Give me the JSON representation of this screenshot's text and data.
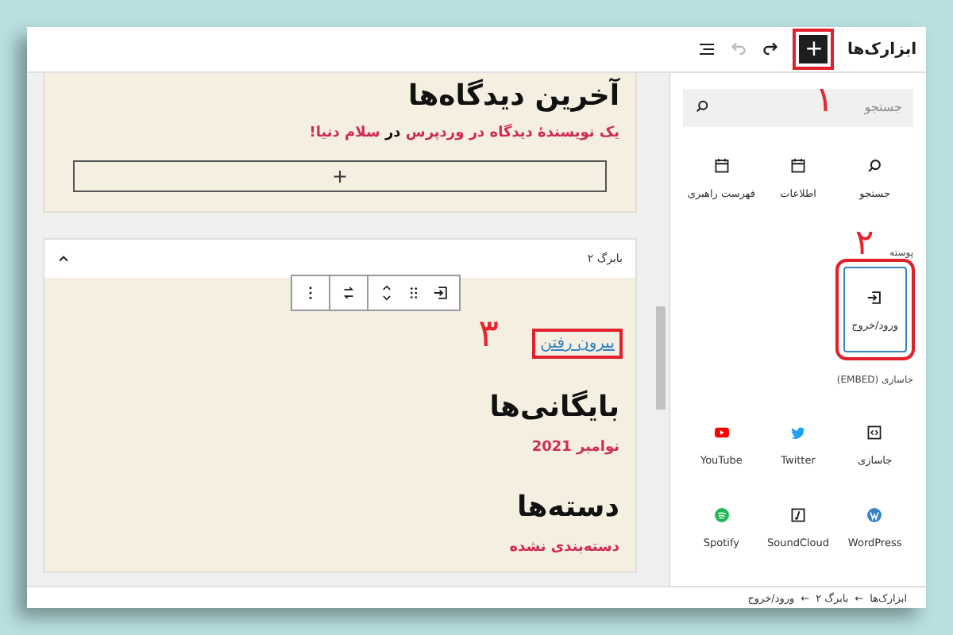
{
  "header": {
    "title": "ابزارک‌ها",
    "add_button": {
      "label": "+",
      "highlighted": true,
      "annotation": "۱"
    },
    "tools": [
      {
        "kind": "redo",
        "disabled": false
      },
      {
        "kind": "undo",
        "disabled": true
      },
      {
        "kind": "list",
        "disabled": false
      }
    ]
  },
  "sidebar": {
    "search": {
      "placeholder": "جستجو"
    },
    "tiles": [
      {
        "kind": "search",
        "label": "جستجو",
        "selected": false
      },
      {
        "kind": "calendar",
        "label": "اطلاعات",
        "selected": false
      },
      {
        "kind": "calendar",
        "label": "فهرست راهبری",
        "selected": false
      }
    ],
    "theme": {
      "heading": "پوسته",
      "annotation": "۲",
      "tiles": [
        {
          "kind": "login",
          "label": "ورود/خروج",
          "selected": true,
          "highlighted": true
        }
      ]
    },
    "embeds": {
      "heading": "جاسازی (EMBED)",
      "tiles": [
        {
          "kind": "embed",
          "label": "جاسازی",
          "selected": false
        },
        {
          "kind": "twitter",
          "label": "Twitter",
          "selected": false
        },
        {
          "kind": "youtube",
          "label": "YouTube",
          "selected": false
        },
        {
          "kind": "wordpress",
          "label": "WordPress",
          "selected": false
        },
        {
          "kind": "soundcloud",
          "label": "SoundCloud",
          "selected": false
        },
        {
          "kind": "spotify",
          "label": "Spotify",
          "selected": false
        }
      ]
    }
  },
  "content": {
    "comments": {
      "heading": "آخرین دیدگاه‌ها",
      "line": [
        {
          "kind": "link",
          "text": "یک نویسندهٔ دیدگاه در وردپرس"
        },
        {
          "kind": "plain",
          "text": "در"
        },
        {
          "kind": "link",
          "text": "سلام دنیا!"
        }
      ],
      "add_label": "+"
    },
    "widget_area": {
      "title": "بابرگ ۲",
      "expanded": true,
      "link": {
        "text": "بیرون رفتن",
        "highlighted": true,
        "annotation": "۳"
      },
      "archives": {
        "heading": "بایگانی‌ها",
        "item": "نوامبر 2021"
      },
      "categories": {
        "heading": "دسته‌ها",
        "item": "دسته‌بندی نشده"
      }
    }
  },
  "breadcrumb": {
    "separator": "←",
    "items": [
      "ابزارک‌ها",
      "بابرگ ۲",
      "ورود/خروج"
    ]
  }
}
